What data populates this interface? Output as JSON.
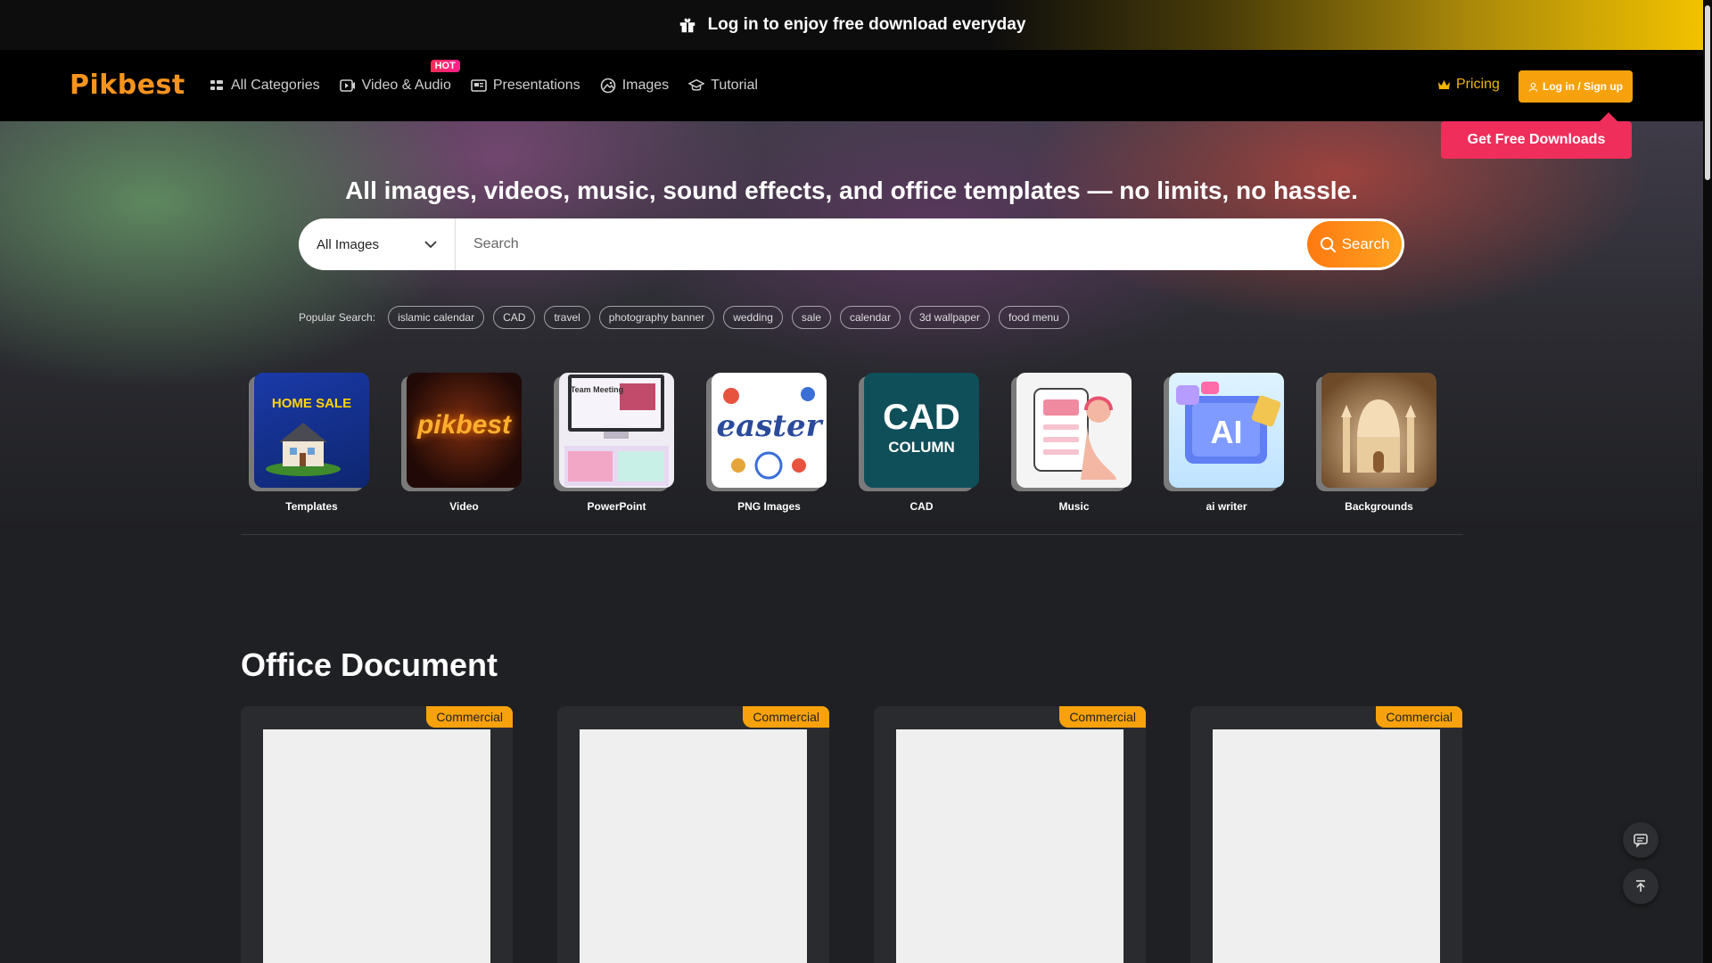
{
  "promo": {
    "text": "Log in to enjoy free download everyday"
  },
  "header": {
    "logo": "Pikbest",
    "nav": [
      {
        "label": "All Categories",
        "icon": "grid-icon"
      },
      {
        "label": "Video & Audio",
        "icon": "video-icon",
        "badge": "HOT"
      },
      {
        "label": "Presentations",
        "icon": "presentation-icon"
      },
      {
        "label": "Images",
        "icon": "image-icon"
      },
      {
        "label": "Tutorial",
        "icon": "graduation-cap-icon"
      }
    ],
    "pricing": "Pricing",
    "login": "Log in / Sign up",
    "free_downloads": "Get Free Downloads"
  },
  "hero": {
    "title": "All images, videos, music, sound effects, and office templates — no limits, no hassle.",
    "search": {
      "category": "All Images",
      "placeholder": "Search",
      "button": "Search"
    },
    "popular_label": "Popular Search:",
    "popular_tags": [
      "islamic calendar",
      "CAD",
      "travel",
      "photography banner",
      "wedding",
      "sale",
      "calendar",
      "3d wallpaper",
      "food menu"
    ]
  },
  "categories": [
    {
      "label": "Templates",
      "thumb_text": "HOME SALE"
    },
    {
      "label": "Video",
      "thumb_text": "pikbest"
    },
    {
      "label": "PowerPoint",
      "thumb_text": "Team Meeting"
    },
    {
      "label": "PNG Images",
      "thumb_text": "easter"
    },
    {
      "label": "CAD",
      "thumb_text": "CAD",
      "thumb_sub": "COLUMN"
    },
    {
      "label": "Music",
      "thumb_text": ""
    },
    {
      "label": "ai writer",
      "thumb_text": "AI"
    },
    {
      "label": "Backgrounds",
      "thumb_text": ""
    }
  ],
  "section": {
    "title": "Office Document",
    "cards": [
      {
        "badge": "Commercial"
      },
      {
        "badge": "Commercial"
      },
      {
        "badge": "Commercial"
      },
      {
        "badge": "Commercial"
      }
    ]
  },
  "colors": {
    "accent_orange": "#f7a20c",
    "cta_pink": "#ef2e5b",
    "logo_orange": "#f7941d"
  }
}
